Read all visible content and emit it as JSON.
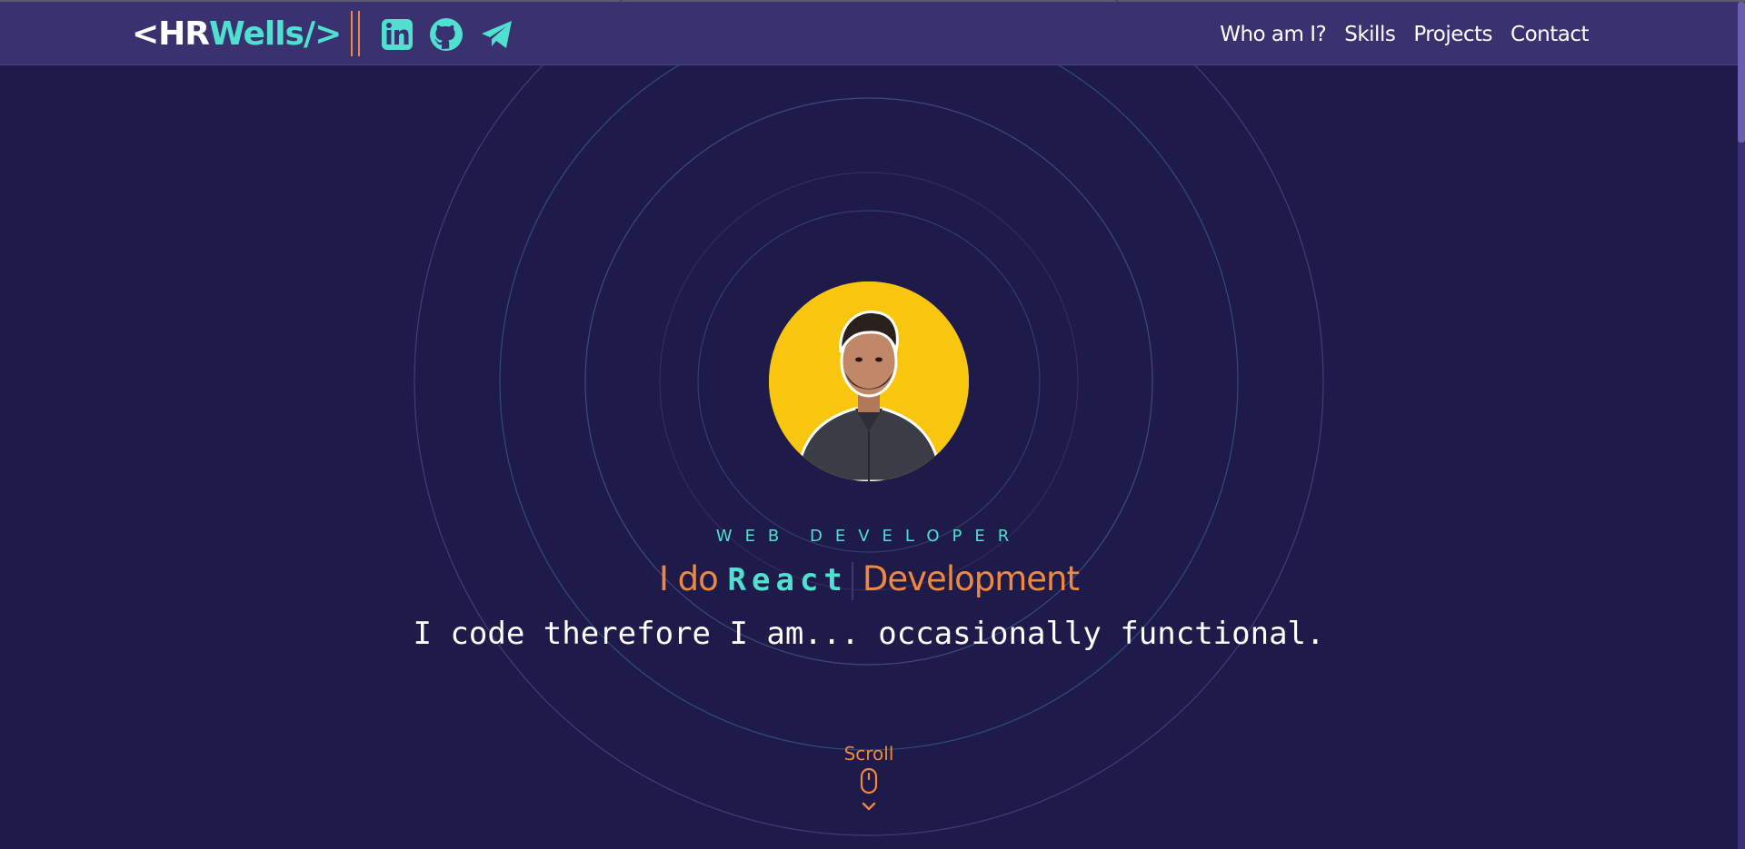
{
  "header": {
    "logo_left": "<HR",
    "logo_accent": "Wells/>",
    "social": [
      {
        "icon": "linkedin-icon"
      },
      {
        "icon": "github-icon"
      },
      {
        "icon": "telegram-icon"
      }
    ],
    "nav": [
      {
        "label": "Who am I?"
      },
      {
        "label": "Skills"
      },
      {
        "label": "Projects"
      },
      {
        "label": "Contact"
      }
    ]
  },
  "hero": {
    "role": "WEB DEVELOPER",
    "tagline_prefix": "I do",
    "tagline_tech": "React",
    "tagline_suffix": "Development",
    "motto": "I code therefore I am... occasionally functional.",
    "scroll_label": "Scroll"
  },
  "colors": {
    "background": "#1e1a4a",
    "header": "#3a3170",
    "accent_teal": "#4fe0cf",
    "accent_orange": "#f0883e",
    "avatar_bg": "#f8c60e"
  }
}
